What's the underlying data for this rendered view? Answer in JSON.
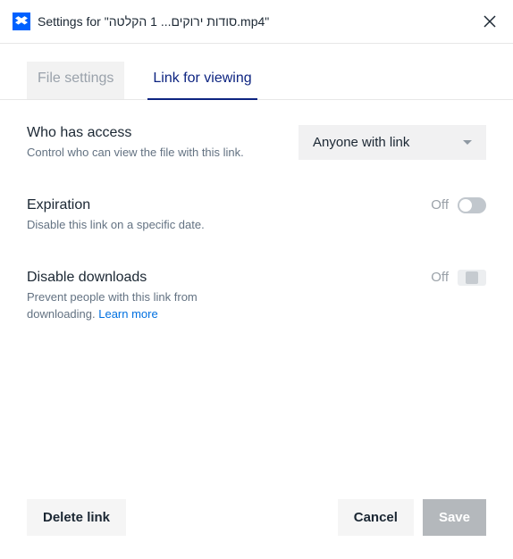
{
  "header": {
    "title": "Settings for \"סודות ירוקים... 1 הקלטה.mp4\""
  },
  "tabs": {
    "file_settings": "File settings",
    "link_for_viewing": "Link for viewing"
  },
  "access": {
    "title": "Who has access",
    "desc": "Control who can view the file with this link.",
    "dropdown_value": "Anyone with link"
  },
  "expiration": {
    "title": "Expiration",
    "desc": "Disable this link on a specific date.",
    "state": "Off"
  },
  "downloads": {
    "title": "Disable downloads",
    "desc": "Prevent people with this link from downloading. ",
    "learn_more": "Learn more",
    "state": "Off"
  },
  "footer": {
    "delete": "Delete link",
    "cancel": "Cancel",
    "save": "Save"
  }
}
